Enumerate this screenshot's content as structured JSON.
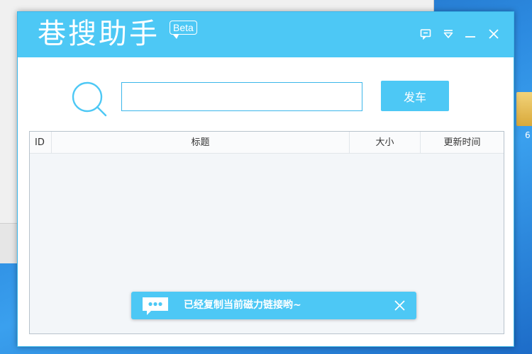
{
  "window": {
    "title": "巷搜助手",
    "badge": "Beta"
  },
  "controls": {
    "feedback": "feedback-icon",
    "skin": "skin-icon",
    "minimize": "minimize-icon",
    "close": "close-icon"
  },
  "search": {
    "value": "",
    "button_label": "发车"
  },
  "table": {
    "columns": [
      "ID",
      "标题",
      "大小",
      "更新时间"
    ],
    "rows": []
  },
  "toast": {
    "message": "已经复制当前磁力链接哟~"
  },
  "desktop": {
    "icon_label": "6"
  },
  "colors": {
    "accent": "#4dc8f5",
    "border": "#3bb6ea"
  }
}
